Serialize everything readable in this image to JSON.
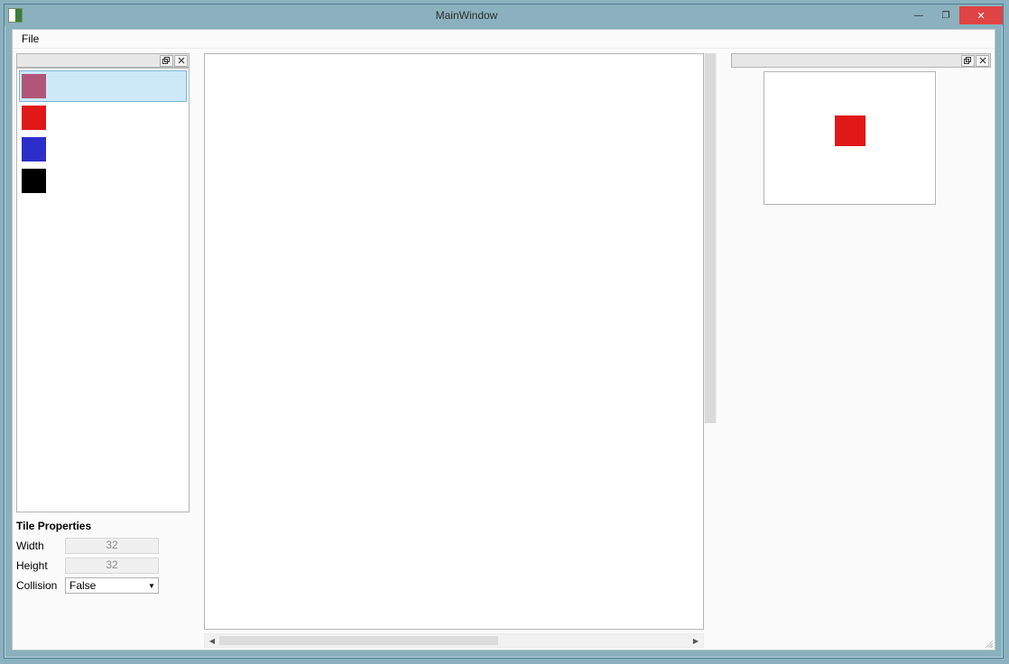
{
  "window": {
    "title": "MainWindow"
  },
  "menubar": {
    "file": "File"
  },
  "palette": {
    "tiles": [
      {
        "color": "#b05678",
        "selected": true
      },
      {
        "color": "#e11818",
        "selected": false
      },
      {
        "color": "#2c2ec9",
        "selected": false
      },
      {
        "color": "#000000",
        "selected": false
      }
    ]
  },
  "tile_properties": {
    "heading": "Tile Properties",
    "width_label": "Width",
    "width_value": "32",
    "height_label": "Height",
    "height_value": "32",
    "collision_label": "Collision",
    "collision_value": "False"
  },
  "preview": {
    "swatch_color": "#e11818"
  },
  "sysbuttons": {
    "minimize": "—",
    "maximize": "❐",
    "close": "✕"
  }
}
